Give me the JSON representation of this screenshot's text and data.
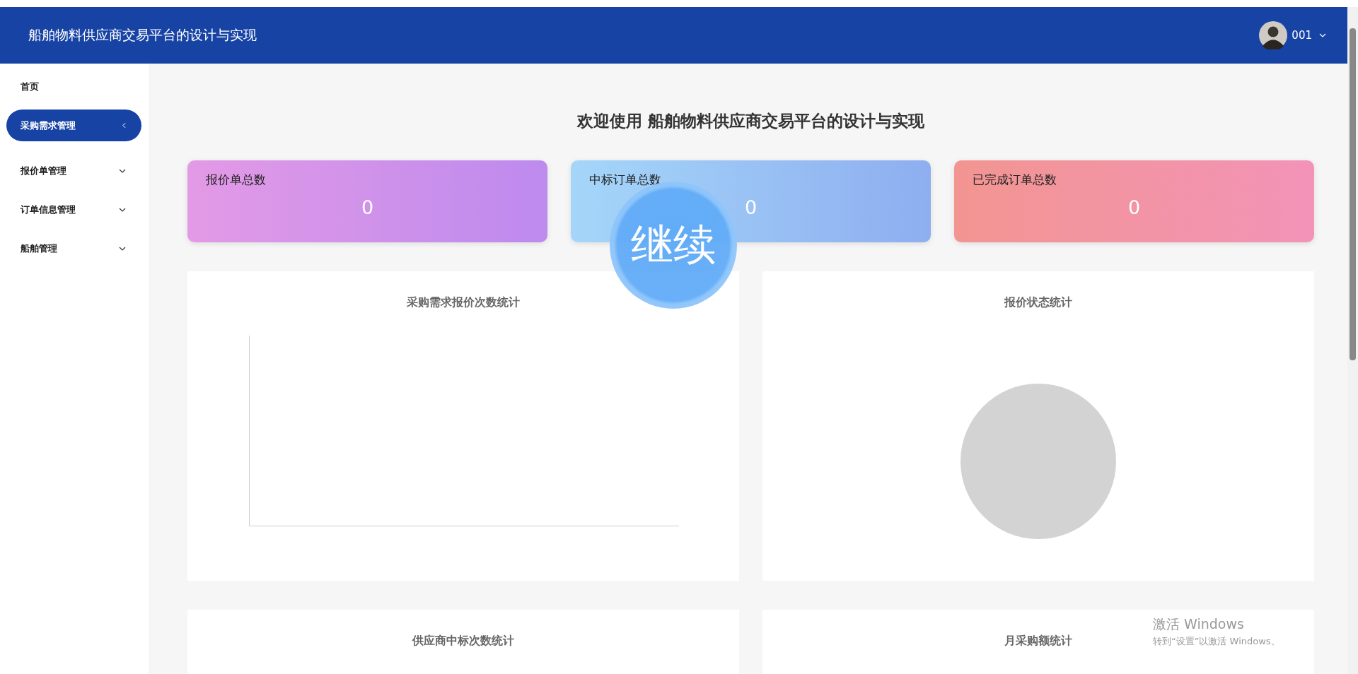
{
  "header": {
    "title": "船舶物料供应商交易平台的设计与实现",
    "user": {
      "name": "001"
    }
  },
  "sidebar": {
    "items": [
      {
        "label": "首页",
        "selected": false,
        "expandable": false
      },
      {
        "label": "采购需求管理",
        "selected": true,
        "expandable": true
      },
      {
        "label": "报价单管理",
        "selected": false,
        "expandable": true
      },
      {
        "label": "订单信息管理",
        "selected": false,
        "expandable": true
      },
      {
        "label": "船舶管理",
        "selected": false,
        "expandable": true
      }
    ]
  },
  "welcome": "欢迎使用 船舶物料供应商交易平台的设计与实现",
  "stat_cards": [
    {
      "label": "报价单总数",
      "value": "0",
      "kind": "purple"
    },
    {
      "label": "中标订单总数",
      "value": "0",
      "kind": "blue"
    },
    {
      "label": "已完成订单总数",
      "value": "0",
      "kind": "red"
    }
  ],
  "panels": [
    {
      "title": "采购需求报价次数统计",
      "kind": "axes"
    },
    {
      "title": "报价状态统计",
      "kind": "pie"
    },
    {
      "title": "供应商中标次数统计",
      "kind": "axes-cut"
    },
    {
      "title": "月采购额统计",
      "kind": "axes-cut"
    }
  ],
  "overlay": {
    "label": "继续"
  },
  "os_notice": {
    "title": "激活 Windows",
    "text": "转到“设置”以激活 Windows。"
  }
}
